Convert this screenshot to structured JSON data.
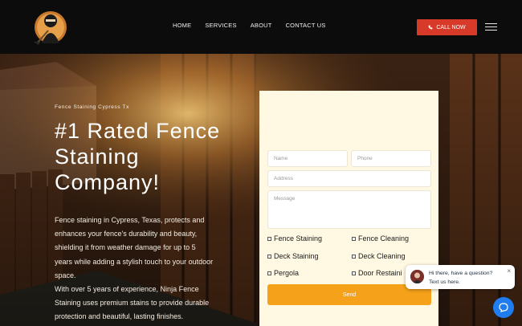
{
  "nav": {
    "items": [
      "HOME",
      "SERVICES",
      "ABOUT",
      "CONTACT US"
    ],
    "call_label": "CALL NOW"
  },
  "hero": {
    "eyebrow": "Fence Staining Cypress Tx",
    "title_lines": [
      "#1 Rated Fence",
      "Staining",
      "Company!"
    ],
    "paragraph_lines": [
      "Fence staining in Cypress, Texas, protects and",
      "enhances your fence's durability and beauty,",
      "shielding it from weather damage for up to 5",
      "years while adding a stylish touch to your outdoor",
      "space.",
      "With over 5 years of experience, Ninja Fence",
      "Staining uses premium stains to provide durable",
      "protection and beautiful, lasting finishes."
    ]
  },
  "form": {
    "placeholders": {
      "name": "Name",
      "phone": "Phone",
      "address": "Address",
      "message": "Message"
    },
    "services": [
      "Fence Staining",
      "Fence Cleaning",
      "Deck Staining",
      "Deck Cleaning",
      "Pergola",
      "Door Restaini"
    ],
    "send_label": "Send"
  },
  "chat": {
    "line1": "Hi there, have a question?",
    "line2": "Text us here.",
    "close": "×"
  },
  "colors": {
    "header_bg": "#0c0c0c",
    "call_btn": "#d83a2a",
    "form_bg": "#fff8e2",
    "send_btn": "#f5a11a",
    "chat_launcher": "#1f7df0"
  }
}
